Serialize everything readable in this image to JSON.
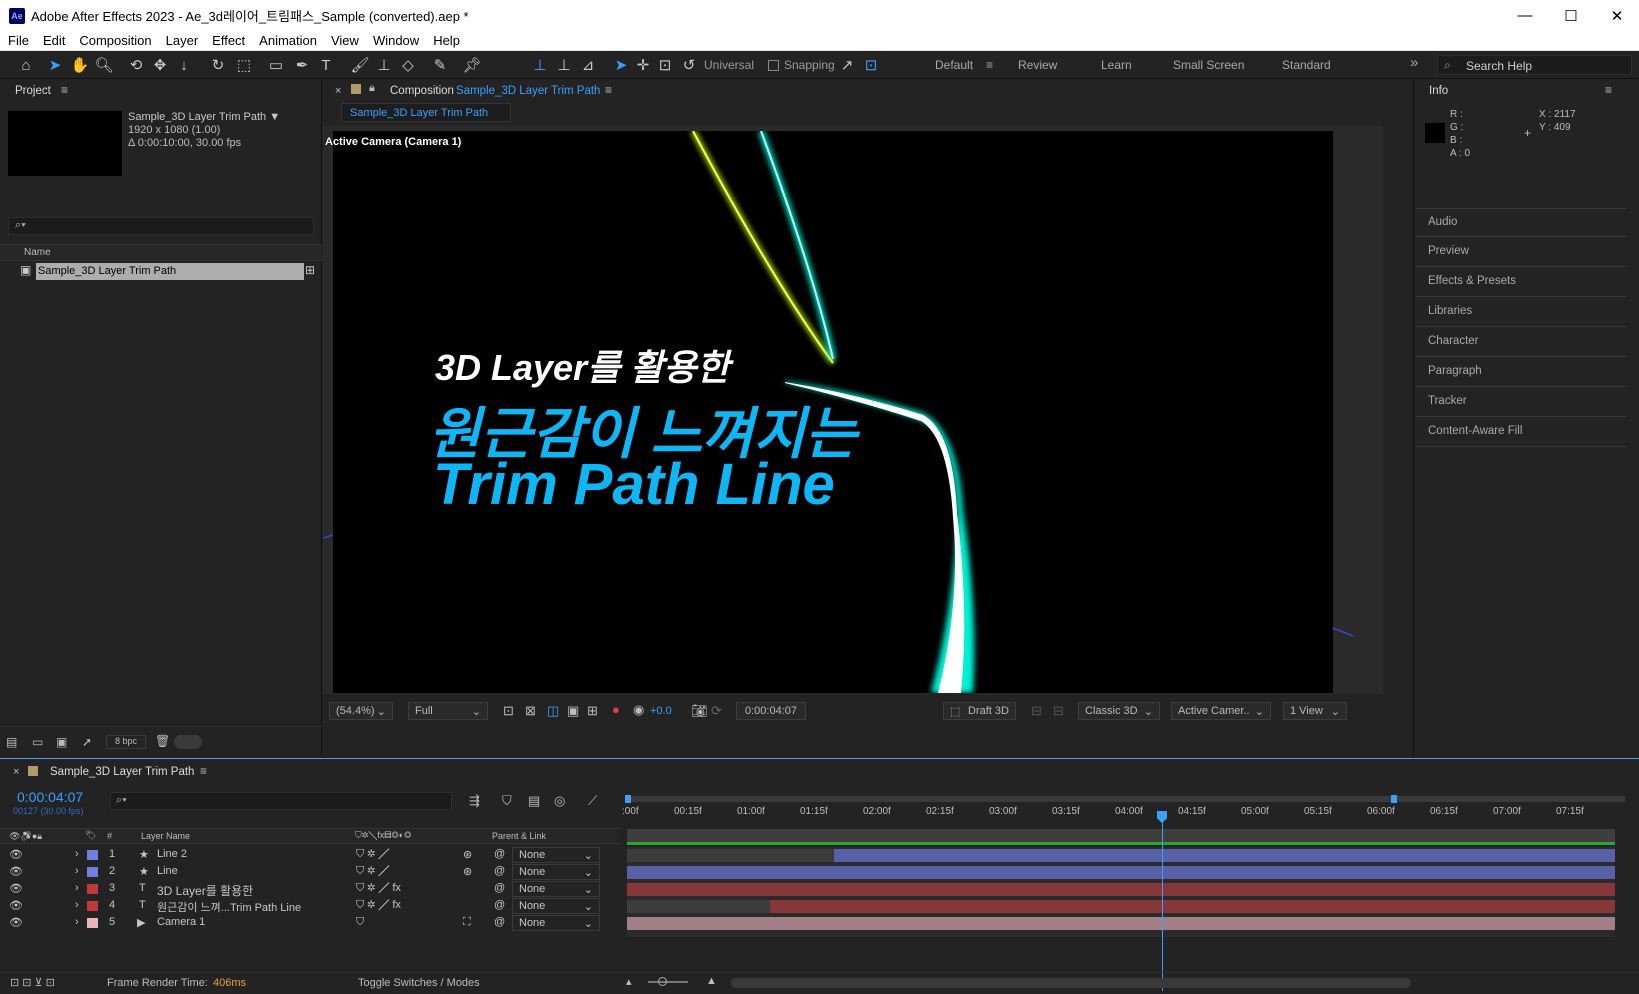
{
  "window": {
    "app_title": "Adobe After Effects 2023 - Ae_3d레이어_트림패스_Sample (converted).aep *",
    "app_icon": "Ae",
    "minimize": "—",
    "maximize": "☐",
    "close": "✕"
  },
  "menu": [
    "File",
    "Edit",
    "Composition",
    "Layer",
    "Effect",
    "Animation",
    "View",
    "Window",
    "Help"
  ],
  "toolbar": {
    "axis_mode": "Universal",
    "snapping": "Snapping",
    "workspaces": [
      "Default",
      "Review",
      "Learn",
      "Small Screen",
      "Standard"
    ],
    "active_workspace": "Default",
    "search_placeholder": "Search Help",
    "more": "»"
  },
  "project": {
    "title": "Project",
    "comp_name": "Sample_3D Layer Trim Path ▼",
    "dims": "1920 x 1080 (1.00)",
    "duration": "Δ 0:00:10:00, 30.00 fps",
    "search_icon": "⌕▾",
    "col_name": "Name",
    "item": "Sample_3D Layer Trim Path",
    "bpc": "8 bpc"
  },
  "comp": {
    "title": "Composition",
    "comp_link": "Sample_3D Layer Trim Path",
    "tab": "Sample_3D Layer Trim Path",
    "camera_label": "Active Camera (Camera 1)",
    "line1": "3D Layer를 활용한",
    "line2": "원근감이 느껴지는",
    "line3": "Trim Path Line",
    "zoom": "(54.4%)",
    "resolution": "Full",
    "exposure": "+0.0",
    "timecode": "0:00:04:07",
    "draft3d": "Draft 3D",
    "renderer": "Classic 3D",
    "view": "Active Camer..",
    "views": "1 View"
  },
  "info": {
    "title": "Info",
    "r": "R :",
    "g": "G :",
    "b": "B :",
    "a": "A :  0",
    "x": "X : 2117",
    "y": "Y : 409"
  },
  "panels": [
    "Audio",
    "Preview",
    "Effects & Presets",
    "Libraries",
    "Character",
    "Paragraph",
    "Tracker",
    "Content-Aware Fill"
  ],
  "timeline": {
    "comp_tab": "Sample_3D Layer Trim Path",
    "timecode": "0:00:04:07",
    "frames": "00127 (30.00 fps)",
    "col_num": "#",
    "col_layer": "Layer Name",
    "col_parent": "Parent & Link",
    "ruler": [
      ":00f",
      "00:15f",
      "01:00f",
      "01:15f",
      "02:00f",
      "02:15f",
      "03:00f",
      "03:15f",
      "04:00f",
      "04:15f",
      "05:00f",
      "05:15f",
      "06:00f",
      "06:15f",
      "07:00f",
      "07:15f"
    ],
    "layers": [
      {
        "num": "1",
        "type": "★",
        "name": "Line 2",
        "parent": "None",
        "color": "#6f7ee0"
      },
      {
        "num": "2",
        "type": "★",
        "name": "Line",
        "parent": "None",
        "color": "#6f7ee0"
      },
      {
        "num": "3",
        "type": "T",
        "name": "3D Layer를 활용한",
        "parent": "None",
        "color": "#c0393b"
      },
      {
        "num": "4",
        "type": "T",
        "name": "원근감이 느껴...Trim Path Line",
        "parent": "None",
        "color": "#c0393b"
      },
      {
        "num": "5",
        "type": "▶",
        "name": "Camera 1",
        "parent": "None",
        "color": "#e8b4bc"
      }
    ],
    "render_label": "Frame Render Time:",
    "render_value": "406ms",
    "toggle": "Toggle Switches / Modes"
  }
}
